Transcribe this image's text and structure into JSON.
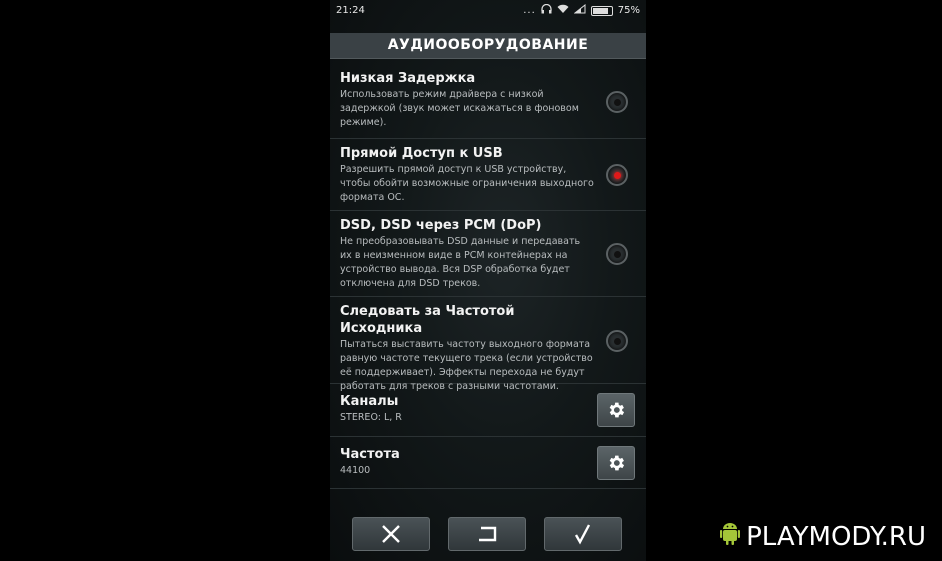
{
  "status": {
    "time": "21:24",
    "dots": "...",
    "battery": "75%"
  },
  "header": {
    "title": "АУДИООБОРУДОВАНИЕ"
  },
  "items": [
    {
      "title": "Низкая Задержка",
      "desc": "Использовать режим драйвера с низкой задержкой (звук может искажаться в фоновом режиме).",
      "checked": false
    },
    {
      "title": "Прямой Доступ к USB",
      "desc": "Разрешить прямой доступ к USB устройству, чтобы обойти возможные ограничения выходного формата ОС.",
      "checked": true
    },
    {
      "title": "DSD, DSD через PCM (DoP)",
      "desc": "Не преобразовывать DSD данные и передавать их в неизменном виде в PCM контейнерах на устройство вывода. Вся DSP обработка будет отключена для DSD треков.",
      "checked": false
    },
    {
      "title": "Следовать за Частотой Исходника",
      "desc": "Пытаться выставить частоту выходного формата равную частоте текущего трека (если устройство её поддерживает). Эффекты перехода не будут работать для треков с разными частотами.",
      "checked": false
    }
  ],
  "settings": [
    {
      "title": "Каналы",
      "value": "STEREO: L, R"
    },
    {
      "title": "Частота",
      "value": "44100"
    }
  ],
  "icons": {
    "settings": "gear-icon",
    "cancel": "close-icon",
    "reset": "undo-icon",
    "confirm": "check-icon"
  },
  "colors": {
    "accent_on": "#e01919",
    "header_bg": "#3a4145"
  },
  "watermark": {
    "text": "PLAYMODY.RU"
  }
}
